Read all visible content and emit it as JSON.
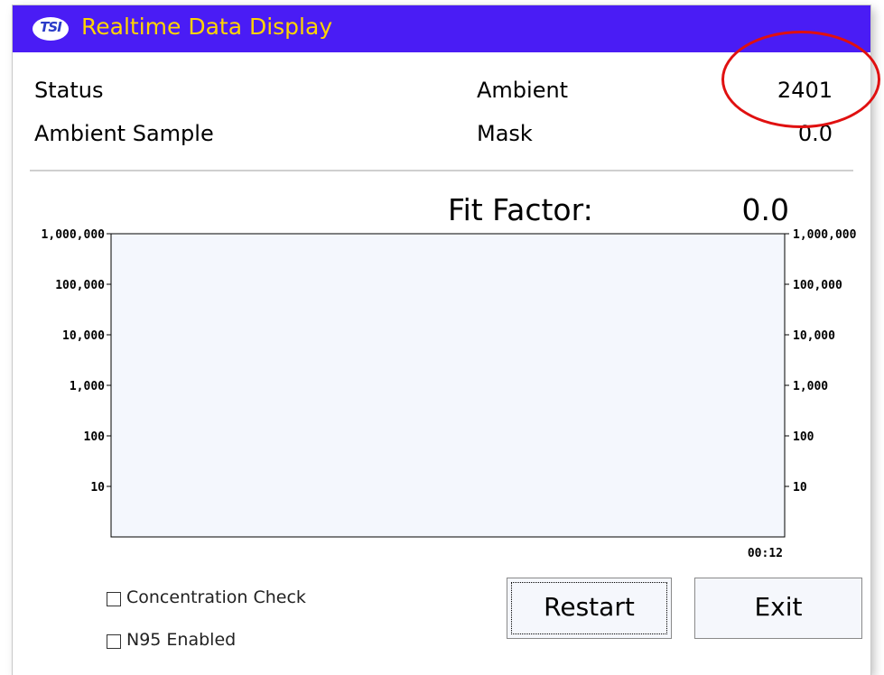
{
  "window": {
    "logo_text": "TSI",
    "title": "Realtime Data Display"
  },
  "readings": {
    "status_label": "Status",
    "status_value": "",
    "ambient_sample_label": "Ambient Sample",
    "ambient_label": "Ambient",
    "ambient_value": "2401",
    "mask_label": "Mask",
    "mask_value": "0.0"
  },
  "fit_factor": {
    "label": "Fit Factor:",
    "value": "0.0"
  },
  "chart_data": {
    "type": "line",
    "title": "",
    "xlabel": "",
    "ylabel": "",
    "y_scale": "log",
    "ylim": [
      1,
      1000000
    ],
    "y_ticks": [
      1000000,
      100000,
      10000,
      1000,
      100,
      10
    ],
    "y_tick_labels": [
      "1,000,000",
      "100,000",
      "10,000",
      "1,000",
      "100",
      "10"
    ],
    "x_tick_labels": [
      "00:12"
    ],
    "series": [],
    "background": "#f4f7fd",
    "grid": false
  },
  "options": {
    "concentration_check_label": "Concentration Check",
    "concentration_check_checked": false,
    "n95_enabled_label": "N95 Enabled",
    "n95_enabled_checked": false
  },
  "buttons": {
    "restart_label": "Restart",
    "exit_label": "Exit"
  },
  "colors": {
    "titlebar": "#4a1cf5",
    "title_text": "#ffd400",
    "annotation_circle": "#e01010"
  }
}
